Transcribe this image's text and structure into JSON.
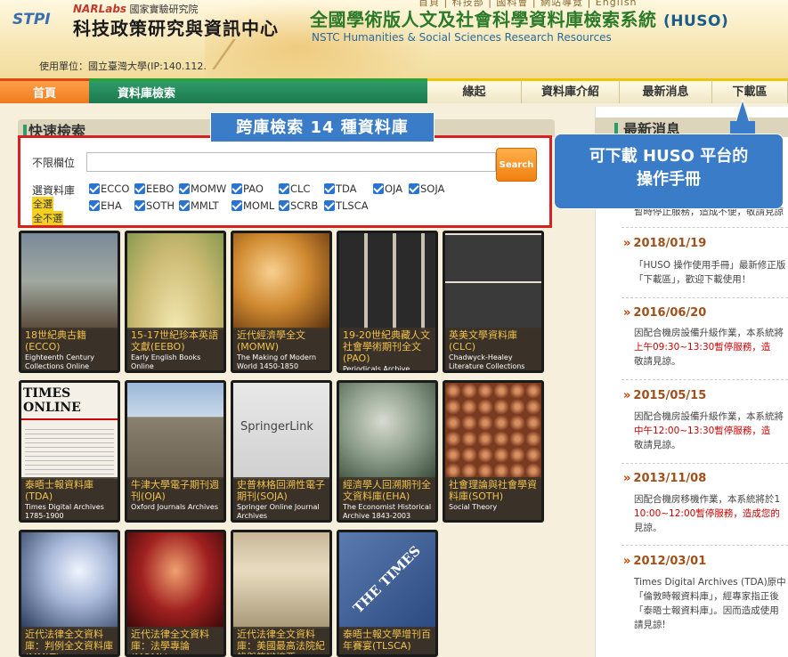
{
  "header": {
    "top_links": "首頁 | 科技部 | 國科會 | 網站導覽 | English",
    "stpi_logo": "STPI",
    "narlabs_brand": "NARLabs",
    "narlabs_org": "國家實驗研究院",
    "org_name": "科技政策研究與資訊中心",
    "system_title": "全國學術版人文及社會科學資料庫檢索系統",
    "system_abbr": "(HUSO)",
    "system_subtitle": "NSTC Humanities & Social Sciences Research Resources",
    "user_line": "使用單位：國立臺灣大學(IP:140.112."
  },
  "nav": {
    "home": "首頁",
    "database_search": "資料庫檢索",
    "items": [
      "緣起",
      "資料庫介紹",
      "最新消息",
      "下載區"
    ]
  },
  "quick_search": {
    "title": "快速檢索",
    "annotation": "跨庫檢索 14 種資料庫",
    "field_label": "不限欄位",
    "input_value": "",
    "search_button": "Search",
    "select_label": "選資料庫",
    "select_all": "全選",
    "select_none": "全不選",
    "databases_row1": [
      "ECCO",
      "EEBO",
      "MOMW",
      "PAO",
      "CLC",
      "TDA",
      "OJA",
      "SOJA"
    ],
    "databases_row2": [
      "EHA",
      "SOTH",
      "MMLT",
      "MOML",
      "SCRB",
      "TLSCA"
    ]
  },
  "tiles": [
    {
      "zh": "18世紀典古籍(ECCO)",
      "en": "Eighteenth Century Collections Online"
    },
    {
      "zh": "15-17世紀珍本英語文獻(EEBO)",
      "en": "Early English Books Online"
    },
    {
      "zh": "近代經濟學全文(MOMW)",
      "en": "The Making of Modern World 1450-1850"
    },
    {
      "zh": "19-20世紀典藏人文社會學術期刊全文(PAO)",
      "en": "Periodicals Archive Online"
    },
    {
      "zh": "英美文學資料庫(CLC)",
      "en": "Chadwyck-Healey Literature Collections"
    },
    {
      "zh": "泰晤士報資料庫(TDA)",
      "en": "Times Digital Archives 1785-1900"
    },
    {
      "zh": "牛津大學電子期刊週刊(OJA)",
      "en": "Oxford Journals Archives"
    },
    {
      "zh": "史普林格回溯性電子期刊(SOJA)",
      "en": "Springer Online Journal Archives"
    },
    {
      "zh": "經濟學人回溯期刊全文資料庫(EHA)",
      "en": "The Economist Historical Archive 1843-2003"
    },
    {
      "zh": "社會理論與社會學資料庫(SOTH)",
      "en": "Social Theory"
    },
    {
      "zh": "近代法律全文資料庫：判例全文資料庫(MMLT)",
      "en": ""
    },
    {
      "zh": "近代法律全文資料庫：法學專論(MOML)",
      "en": ""
    },
    {
      "zh": "近代法律全文資料庫：美國最高法院紀錄與答辯摘要(SCRB)",
      "en": ""
    },
    {
      "zh": "泰晤士報文學增刊百年賽宴(TLSCA)",
      "en": ""
    }
  ],
  "tile_logos": {
    "times_online": "TIMES ONLINE",
    "springer_link": "SpringerLink",
    "the_times": "THE TIMES"
  },
  "news": {
    "title": "最新消息",
    "partial_top": "暫時停止服務，造成不便，敬請見諒",
    "items": [
      {
        "date": "2018/01/19",
        "lines": [
          "「HUSO 操作使用手冊」最新修正版",
          "「下載區」，歡迎下載使用！"
        ]
      },
      {
        "date": "2016/06/20",
        "lines": [
          "因配合機房設備升級作業，本系統將",
          "上午09:30~13:30暫停服務，造",
          "敬請見諒。"
        ]
      },
      {
        "date": "2015/05/15",
        "lines": [
          "因配合機房設備升級作業，本系統將",
          "中午12:00~13:30暫停服務，造",
          "敬請見諒。"
        ]
      },
      {
        "date": "2013/11/08",
        "lines": [
          "因配合機房移機作業，本系統將於1",
          "10:00~12:00暫停服務，造成您的",
          "見諒。"
        ]
      },
      {
        "date": "2012/03/01",
        "lines": [
          "Times Digital Archives (TDA)原中",
          "「倫敦時報資料庫」，經專家指正後",
          "「泰晤士報資料庫」。因而造成使用",
          "請見諒!"
        ]
      }
    ]
  },
  "download_annotation": {
    "line1": "可下載 HUSO 平台的",
    "line2": "操作手冊"
  },
  "colors": {
    "accent_red": "#d92020",
    "annotation_blue": "#3a7cc8",
    "nav_orange": "#f07a1c",
    "nav_green": "#1c7a4e",
    "title_green": "#2a7a2a"
  }
}
